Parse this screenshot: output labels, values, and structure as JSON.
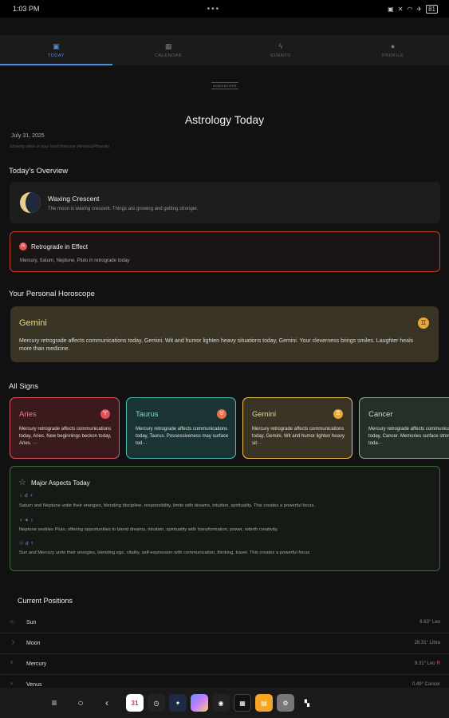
{
  "status_bar": {
    "time": "1:03 PM",
    "dots": "•••",
    "battery": "81"
  },
  "tabs": [
    {
      "label": "TODAY",
      "icon": "today-icon",
      "active": true
    },
    {
      "label": "CALENDAR",
      "icon": "calendar-icon",
      "active": false
    },
    {
      "label": "EVENTS",
      "icon": "bolt-icon",
      "active": false
    },
    {
      "label": "PROFILE",
      "icon": "person-icon",
      "active": false
    }
  ],
  "header": {
    "logo_text": "HOROSCOPE",
    "title": "Astrology Today",
    "date": "July 31, 2025",
    "timezone_note": "Showing dates in your local timezone (America/Phoenix)"
  },
  "overview": {
    "section_title": "Today's Overview",
    "moon_phase": "Waxing Crescent",
    "moon_description": "The moon is waxing crescent. Things are growing and getting stronger.",
    "retrograde_title": "Retrograde in Effect",
    "retrograde_description": "Mercury, Saturn, Neptune, Pluto in retrograde today"
  },
  "personal_horoscope": {
    "section_title": "Your Personal Horoscope",
    "sign": "Gemini",
    "symbol": "♊",
    "text": "Mercury retrograde affects communications today, Gemini. Wit and humor lighten heavy situations today, Gemini. Your cleverness brings smiles. Laughter heals more than medicine."
  },
  "all_signs": {
    "section_title": "All Signs",
    "signs": [
      {
        "name": "Aries",
        "symbol": "♈",
        "text": "Mercury retrograde affects communications today, Aries. New beginnings beckon today, Aries. ···",
        "bg": "#3a1a1c",
        "border": "#e05a63",
        "name_color": "#f07a80",
        "symbol_bg": "#e0505a"
      },
      {
        "name": "Taurus",
        "symbol": "♉",
        "text": "Mercury retrograde affects communications today, Taurus. Possessiveness may surface tod···",
        "bg": "#1a3433",
        "border": "#4ec0b3",
        "name_color": "#7fd8cc",
        "symbol_bg": "#e8704a"
      },
      {
        "name": "Gemini",
        "symbol": "♊",
        "text": "Mercury retrograde affects communications today, Gemini. Wit and humor lighten heavy sit···",
        "bg": "#3a3424",
        "border": "#f0c850",
        "name_color": "#ecd58a",
        "symbol_bg": "#e8a83c"
      },
      {
        "name": "Cancer",
        "symbol": "♋",
        "text": "Mercury retrograde affects communications today, Cancer. Memories surface strongly toda···",
        "bg": "#243028",
        "border": "#9aae9e",
        "name_color": "#cfd8d0",
        "symbol_bg": "#e8a83c"
      }
    ]
  },
  "aspects": {
    "title": "Major Aspects Today",
    "items": [
      {
        "glyph": "♄ ☌ ♆",
        "text": "Saturn and Neptune unite their energies, blending discipline, responsibility, limits with dreams, intuition, spirituality. This creates a powerful focus."
      },
      {
        "glyph": "♆ ✶ ♇",
        "text": "Neptune sextiles Pluto, offering opportunities to blend dreams, intuition, spirituality with transformation, power, rebirth creativity."
      },
      {
        "glyph": "☉ ☌ ☿",
        "text": "Sun and Mercury unite their energies, blending ego, vitality, self-expression with communication, thinking, travel. This creates a powerful focus."
      }
    ]
  },
  "positions": {
    "title": "Current Positions",
    "rows": [
      {
        "glyph": "☉",
        "planet": "Sun",
        "value": "8.63° Leo",
        "retro": ""
      },
      {
        "glyph": "☽",
        "planet": "Moon",
        "value": "28.31° Libra",
        "retro": ""
      },
      {
        "glyph": "☿",
        "planet": "Mercury",
        "value": "9.31° Leo",
        "retro": "R"
      },
      {
        "glyph": "♀",
        "planet": "Venus",
        "value": "0.49° Cancer",
        "retro": ""
      }
    ]
  },
  "navbar": {
    "menu": "≡",
    "home": "○",
    "back": "‹",
    "calendar_day": "31"
  }
}
